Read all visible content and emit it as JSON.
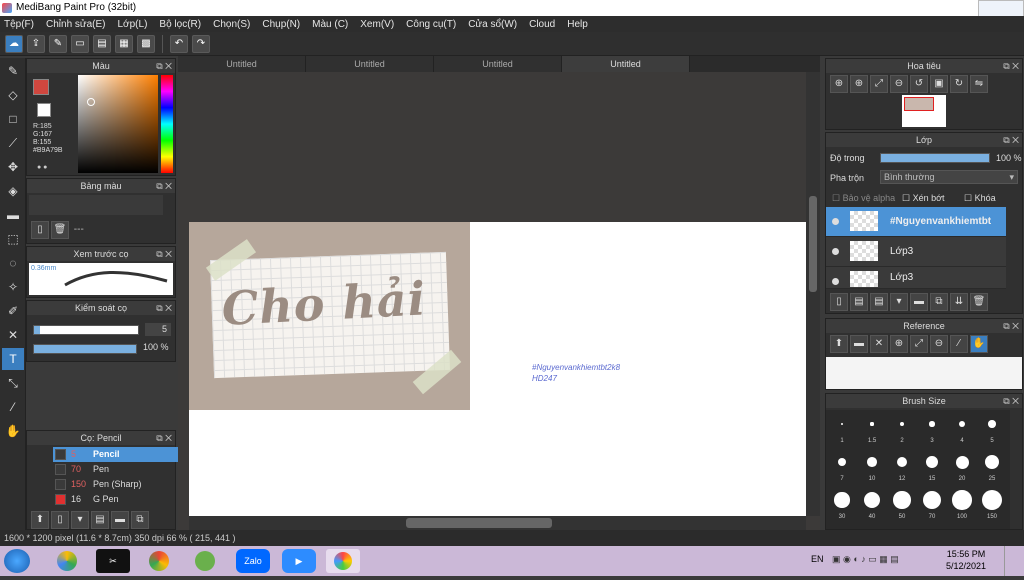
{
  "window": {
    "title": "MediBang Paint Pro (32bit)"
  },
  "menu": [
    "Tệp(F)",
    "Chỉnh sửa(E)",
    "Lớp(L)",
    "Bộ lọc(R)",
    "Chọn(S)",
    "Chụp(N)",
    "Màu (C)",
    "Xem(V)",
    "Công cụ(T)",
    "Cửa sổ(W)",
    "Cloud",
    "Help"
  ],
  "doc_tabs": [
    "Untitled",
    "Untitled",
    "Untitled",
    "Untitled"
  ],
  "color_panel": {
    "title": "Màu",
    "r": "R:185",
    "g": "G:167",
    "b": "B:155",
    "hex": "#B9A79B",
    "fg": "#d0473f",
    "bg": "#ffffff"
  },
  "palette_panel": {
    "title": "Bảng màu",
    "item": "---"
  },
  "brush_preview": {
    "title": "Xem trước cọ",
    "size": "0.36mm"
  },
  "brush_control": {
    "title": "Kiểm soát cọ",
    "size": "5",
    "opacity": "100 %"
  },
  "brush_list": {
    "title": "Cọ: Pencil",
    "items": [
      {
        "size": "5",
        "name": "Pencil"
      },
      {
        "size": "70",
        "name": "Pen"
      },
      {
        "size": "150",
        "name": "Pen (Sharp)"
      },
      {
        "size": "16",
        "name": "G Pen"
      }
    ]
  },
  "canvas": {
    "title_text": "Cho hải",
    "watermark_line1": "#Nguyenvankhiemtbt2k8",
    "watermark_line2": "HD247"
  },
  "navigator": {
    "title": "Hoa tiêu"
  },
  "layer_panel": {
    "title": "Lớp",
    "opacity_label": "Độ trong",
    "opacity_value": "100 %",
    "blend_label": "Pha trộn",
    "blend_value": "Bình thường",
    "protect_alpha": "Bảo vệ alpha",
    "clipping": "Xén bớt",
    "lock": "Khóa",
    "layers": [
      {
        "name": "#Nguyenvankhiemtbt"
      },
      {
        "name": "Lớp3"
      },
      {
        "name": "Lớp3"
      }
    ]
  },
  "reference_panel": {
    "title": "Reference"
  },
  "brush_size_panel": {
    "title": "Brush Size",
    "sizes": [
      "1",
      "1.5",
      "2",
      "3",
      "4",
      "5",
      "7",
      "10",
      "12",
      "15",
      "20",
      "25",
      "30",
      "40",
      "50",
      "70",
      "100",
      "150"
    ]
  },
  "status": {
    "text": "1600 * 1200 pixel   (11.6 * 8.7cm)   350 dpi   66 %   ( 215, 441 )"
  },
  "taskbar": {
    "lang": "EN",
    "time": "15:56 PM",
    "date": "5/12/2021",
    "zalo": "Zalo"
  }
}
